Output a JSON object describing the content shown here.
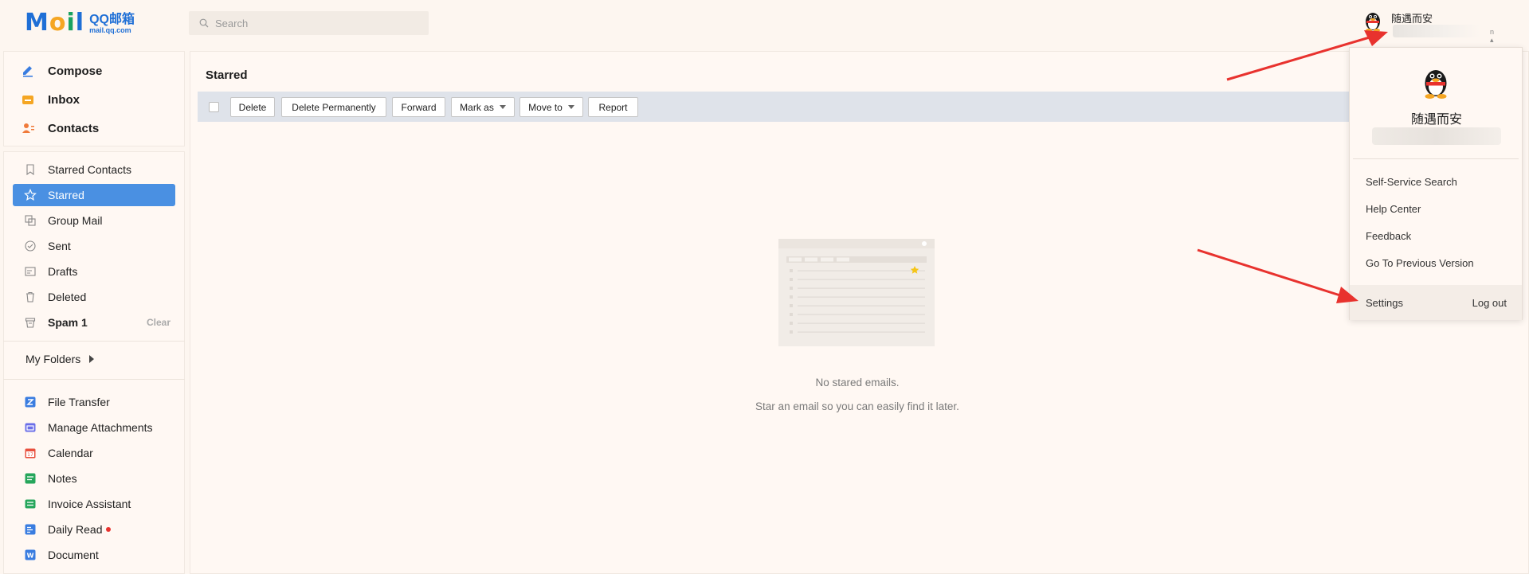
{
  "header": {
    "logo_word_m": "M",
    "logo_word_o": "o",
    "logo_word_i": "i",
    "logo_word_l": "l",
    "logo_cn": "QQ邮箱",
    "logo_url": "mail.qq.com",
    "search_placeholder": "Search",
    "user_name": "随遇而安",
    "user_caret": "n ▴"
  },
  "sidebar": {
    "compose": "Compose",
    "inbox": "Inbox",
    "contacts": "Contacts",
    "items": [
      {
        "label": "Starred Contacts"
      },
      {
        "label": "Starred"
      },
      {
        "label": "Group Mail"
      },
      {
        "label": "Sent"
      },
      {
        "label": "Drafts"
      },
      {
        "label": "Deleted"
      },
      {
        "label": "Spam 1",
        "action": "Clear"
      }
    ],
    "my_folders": "My Folders",
    "apps": [
      {
        "label": "File Transfer",
        "color": "#3a7de0"
      },
      {
        "label": "Manage Attachments",
        "color": "#6a6ee8"
      },
      {
        "label": "Calendar",
        "color": "#e8503e"
      },
      {
        "label": "Notes",
        "color": "#26a65b"
      },
      {
        "label": "Invoice Assistant",
        "color": "#26a65b"
      },
      {
        "label": "Daily Read",
        "color": "#3a7de0"
      },
      {
        "label": "Document",
        "color": "#3a7de0"
      }
    ]
  },
  "main": {
    "title": "Starred",
    "toolbar": {
      "delete": "Delete",
      "delete_perm": "Delete Permanently",
      "forward": "Forward",
      "mark_as": "Mark as",
      "move_to": "Move to",
      "report": "Report"
    },
    "empty_title": "No stared emails.",
    "empty_sub": "Star an email so you can easily find it later."
  },
  "dropdown": {
    "name": "随遇而安",
    "items": [
      "Self-Service Search",
      "Help Center",
      "Feedback",
      "Go To Previous Version"
    ],
    "settings": "Settings",
    "logout": "Log out"
  },
  "colors": {
    "accent": "#4a90e2",
    "arrow": "#e8322e",
    "background": "#fdf6f0"
  }
}
